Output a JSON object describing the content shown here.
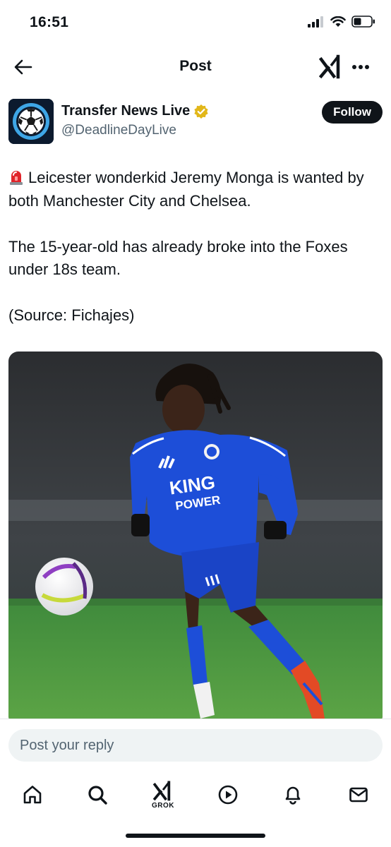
{
  "status_bar": {
    "time": "16:51"
  },
  "nav": {
    "title": "Post"
  },
  "author": {
    "name": "Transfer News Live",
    "handle": "@DeadlineDayLive",
    "follow_label": "Follow"
  },
  "post": {
    "paragraphs": [
      "Leicester wonderkid Jeremy Monga is wanted by both Manchester City and Chelsea.",
      "The 15-year-old has already broke into the Foxes under 18s team.",
      "(Source: Fichajes)"
    ],
    "media": {
      "jersey_text_line1": "KING",
      "jersey_text_line2": "POWER"
    }
  },
  "reply": {
    "placeholder": "Post your reply"
  },
  "tabs": [
    {
      "name": "home",
      "label": ""
    },
    {
      "name": "search",
      "label": ""
    },
    {
      "name": "grok",
      "label": "GROK"
    },
    {
      "name": "video",
      "label": ""
    },
    {
      "name": "notifications",
      "label": ""
    },
    {
      "name": "messages",
      "label": ""
    }
  ],
  "colors": {
    "text": "#0f1419",
    "secondary": "#536471",
    "verified": "#e2b719",
    "jersey": "#1d4ed8"
  }
}
